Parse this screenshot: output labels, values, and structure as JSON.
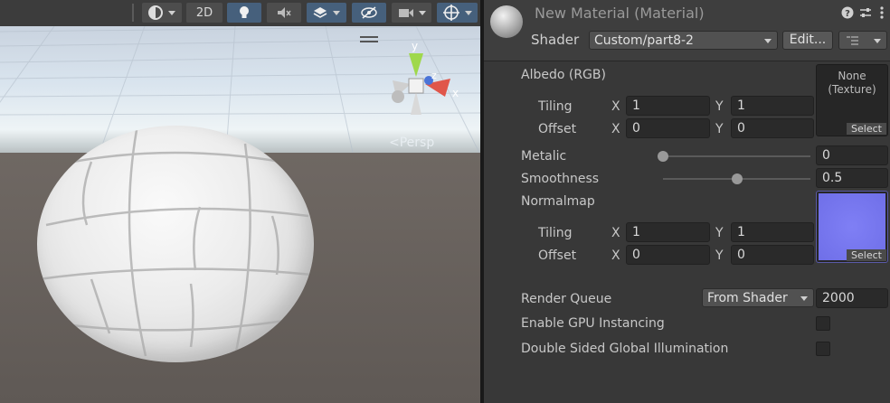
{
  "scene": {
    "toolbar": {
      "mode_2d_label": "2D"
    },
    "gizmo": {
      "y_label": "y",
      "x_label": "x",
      "z_label": "z"
    },
    "projection_label": "<Persp"
  },
  "inspector": {
    "title": "New Material (Material)",
    "shader_label": "Shader",
    "shader_value": "Custom/part8-2",
    "edit_button": "Edit...",
    "albedo": {
      "label": "Albedo (RGB)",
      "texture_none": "None",
      "texture_type": "(Texture)",
      "select_label": "Select",
      "tiling_label": "Tiling",
      "offset_label": "Offset",
      "x_label": "X",
      "y_label": "Y",
      "tiling_x": "1",
      "tiling_y": "1",
      "offset_x": "0",
      "offset_y": "0"
    },
    "metalic": {
      "label": "Metalic",
      "value": "0",
      "fraction": 0.0
    },
    "smoothness": {
      "label": "Smoothness",
      "value": "0.5",
      "fraction": 0.5
    },
    "normalmap": {
      "label": "Normalmap",
      "select_label": "Select",
      "tiling_label": "Tiling",
      "offset_label": "Offset",
      "x_label": "X",
      "y_label": "Y",
      "tiling_x": "1",
      "tiling_y": "1",
      "offset_x": "0",
      "offset_y": "0",
      "preview_color": "#7f7ff5"
    },
    "render_queue": {
      "label": "Render Queue",
      "mode": "From Shader",
      "value": "2000"
    },
    "gpu_instancing": {
      "label": "Enable GPU Instancing",
      "checked": false
    },
    "double_sided_gi": {
      "label": "Double Sided Global Illumination",
      "checked": false
    }
  }
}
